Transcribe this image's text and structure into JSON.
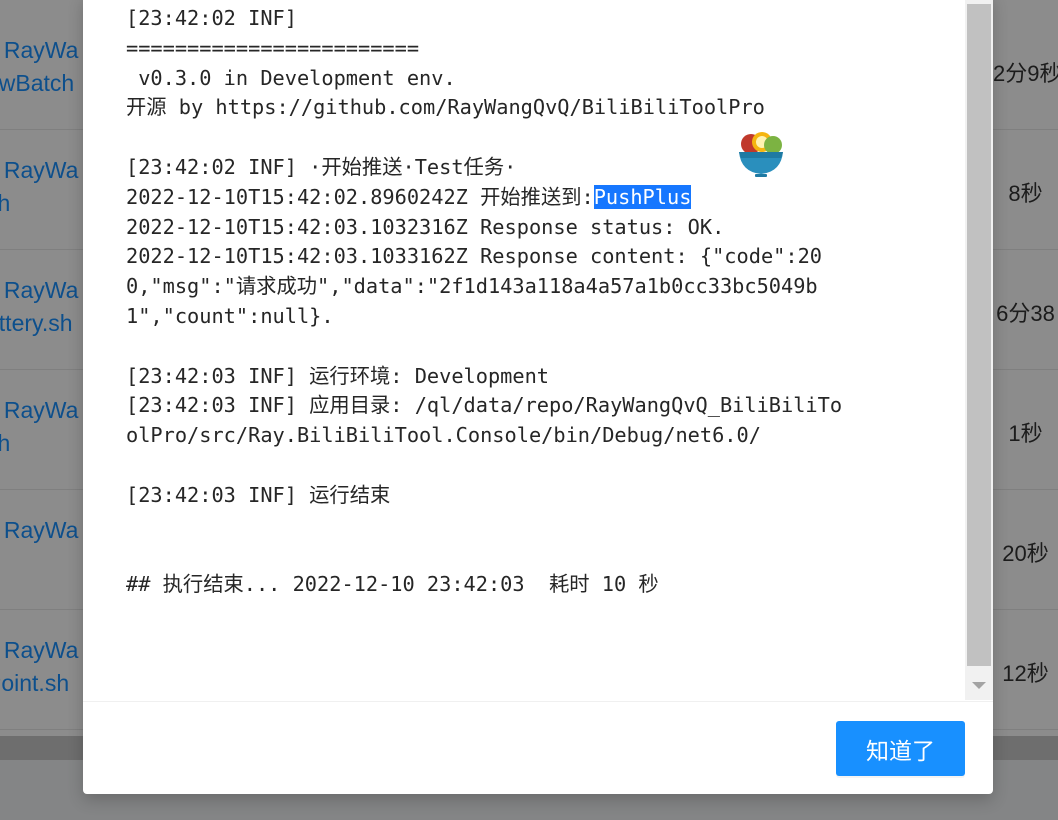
{
  "background_table": {
    "rows": [
      {
        "name_line1": "k RayWa",
        "name_line2": "owBatch",
        "duration": "2分9秒"
      },
      {
        "name_line1": "k RayWa",
        "name_line2": "sh",
        "duration": "8秒"
      },
      {
        "name_line1": "k RayWa",
        "name_line2": "ottery.sh",
        "duration": "6分38"
      },
      {
        "name_line1": "k RayWa",
        "name_line2": "sh",
        "duration": "1秒"
      },
      {
        "name_line1": "k RayWa",
        "name_line2": "h",
        "duration": "20秒"
      },
      {
        "name_line1": "k RayWa",
        "name_line2": "Point.sh",
        "duration": "12秒"
      }
    ]
  },
  "log_modal": {
    "lines": [
      "[23:42:02 INF]",
      "========================",
      " v0.3.0 in Development env.",
      "开源 by https://github.com/RayWangQvQ/BiliBiliToolPro",
      "",
      "[23:42:02 INF] ·开始推送·Test任务·",
      "2022-12-10T15:42:02.8960242Z 开始推送到:",
      "2022-12-10T15:42:03.1032316Z Response status: OK.",
      "2022-12-10T15:42:03.1033162Z Response content: {\"code\":20",
      "0,\"msg\":\"请求成功\",\"data\":\"2f1d143a118a4a57a1b0cc33bc5049b",
      "1\",\"count\":null}.",
      "",
      "[23:42:03 INF] 运行环境: Development",
      "[23:42:03 INF] 应用目录: /ql/data/repo/RayWangQvQ_BiliBiliTo",
      "olPro/src/Ray.BiliBiliTool.Console/bin/Debug/net6.0/",
      "",
      "[23:42:03 INF] 运行结束",
      "",
      "",
      "## 执行结束... 2022-12-10 23:42:03  耗时 10 秒"
    ],
    "selected_text": "PushPlus",
    "ok_button_label": "知道了"
  },
  "colors": {
    "primary": "#1890ff",
    "selection": "#1677ff"
  }
}
